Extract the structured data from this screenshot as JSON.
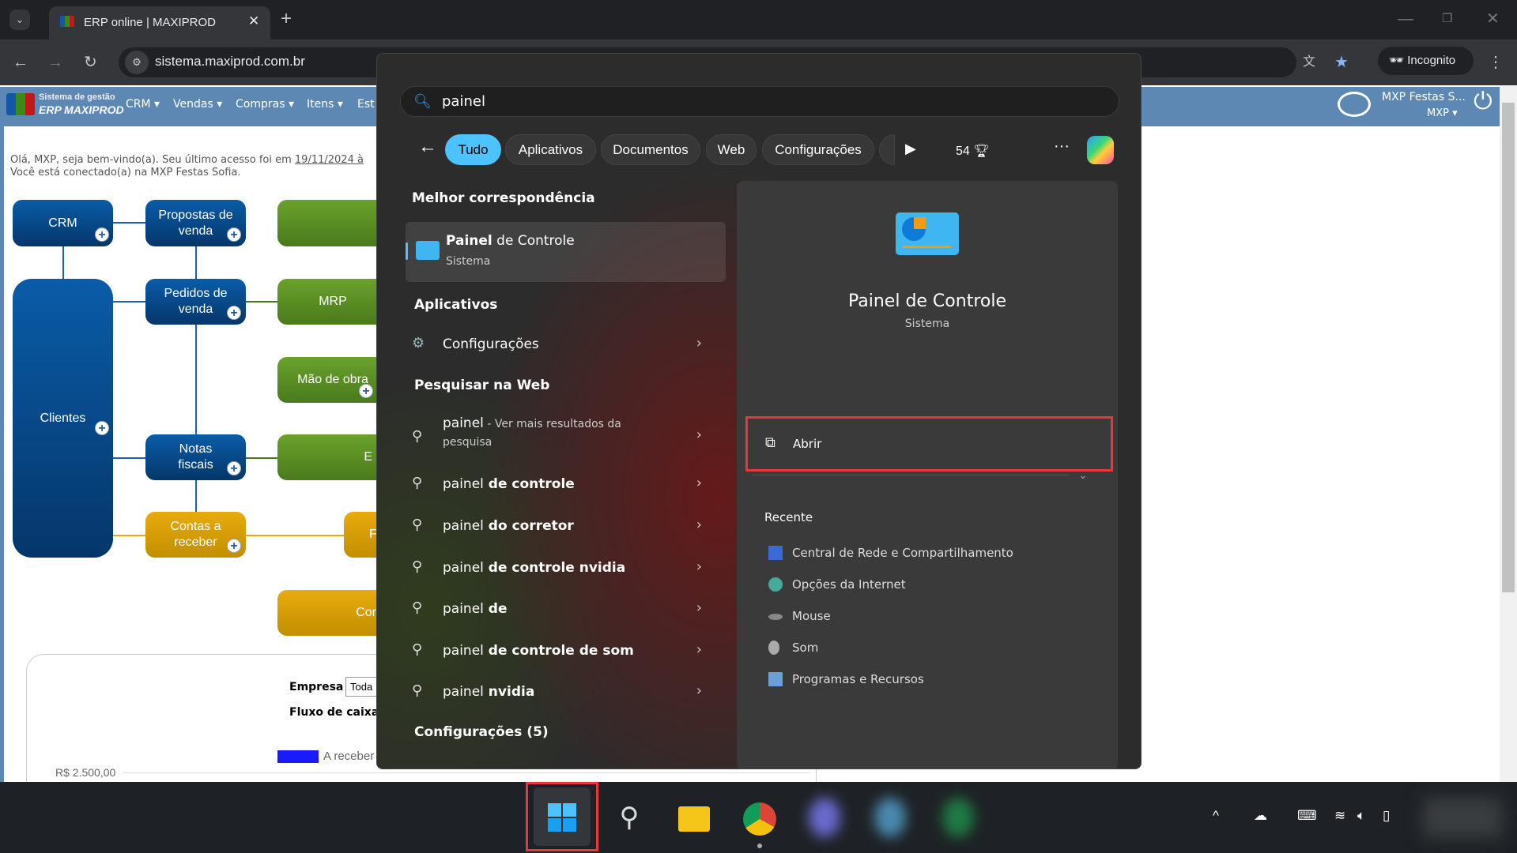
{
  "browser": {
    "tab_title": "ERP online | MAXIPROD",
    "url": "sistema.maxiprod.com.br",
    "incognito_label": "Incognito"
  },
  "erp": {
    "logo_line1": "Sistema de gestão",
    "logo_line2": "ERP MAXIPROD",
    "menu": [
      "CRM",
      "Vendas",
      "Compras",
      "Itens",
      "Est"
    ],
    "company": "MXP Festas S...",
    "user": "MXP",
    "greeting_1": "Olá, MXP, seja bem-vindo(a). Seu último acesso foi em ",
    "greeting_date": "19/11/2024 à",
    "greeting_2": "Você está conectado(a) na MXP Festas Sofia.",
    "flow": {
      "crm": "CRM",
      "propostas": "Propostas de venda",
      "clientes": "Clientes",
      "pedidos": "Pedidos de venda",
      "mrp": "MRP",
      "mao_obra": "Mão de obra",
      "notas": "Notas fiscais",
      "e_box": "E",
      "contas_receber": "Contas a receber",
      "f_box": "F",
      "con_box": "Cor"
    },
    "dashboard": {
      "empresa_label": "Empresa",
      "empresa_value": "Toda",
      "fluxo_label": "Fluxo de caixa",
      "legend_receber": "A receber",
      "legend_color": "#1a1aff",
      "y_tick_top": "R$ 2.500,00"
    }
  },
  "start_menu": {
    "search_value": "painel",
    "filters": [
      "Tudo",
      "Aplicativos",
      "Documentos",
      "Web",
      "Configurações"
    ],
    "active_filter": "Tudo",
    "points": "54",
    "best_match_header": "Melhor correspondência",
    "best_match": {
      "title_bold": "Painel",
      "title_rest": " de Controle",
      "subtitle": "Sistema"
    },
    "apps_header": "Aplicativos",
    "apps": [
      {
        "label": "Configurações"
      }
    ],
    "web_header": "Pesquisar na Web",
    "web_first": {
      "bold": "painel",
      "rest": " - Ver mais resultados da",
      "rest2": "pesquisa"
    },
    "web": [
      {
        "q": "painel",
        "b": " de controle"
      },
      {
        "q": "painel",
        "b": " do corretor"
      },
      {
        "q": "painel",
        "b": " de controle nvidia"
      },
      {
        "q": "painel",
        "b": " de"
      },
      {
        "q": "painel",
        "b": " de controle de som"
      },
      {
        "q": "painel",
        "b": " nvidia"
      }
    ],
    "settings_header": "Configurações (5)",
    "detail": {
      "title": "Painel de Controle",
      "subtitle": "Sistema",
      "open_label": "Abrir",
      "recent_header": "Recente",
      "recent": [
        "Central de Rede e Compartilhamento",
        "Opções da Internet",
        "Mouse",
        "Som",
        "Programas e Recursos"
      ]
    }
  },
  "accent": "#4cc2ff",
  "highlight_color": "#e8383d"
}
